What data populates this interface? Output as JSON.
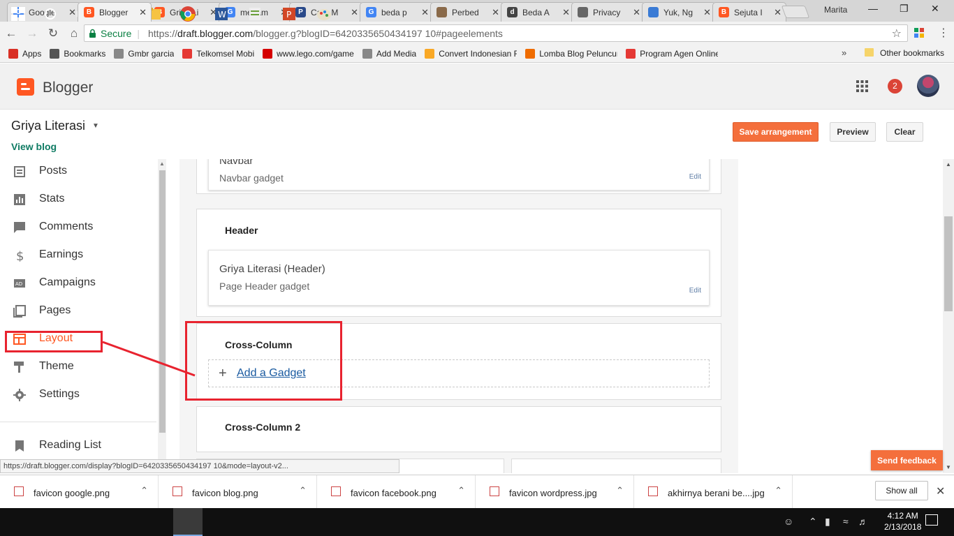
{
  "browser": {
    "tabs": [
      {
        "title": "Google",
        "favicon_color": "#4285f4",
        "favicon_letter": "G"
      },
      {
        "title": "Blogger",
        "favicon_color": "#ff5722",
        "favicon_letter": "B",
        "active": true
      },
      {
        "title": "Griya Li",
        "favicon_color": "#ff5722",
        "favicon_letter": "B"
      },
      {
        "title": "menam",
        "favicon_color": "#4285f4",
        "favicon_letter": "G"
      },
      {
        "title": "Cara M",
        "favicon_color": "#2a4a8a",
        "favicon_letter": "P"
      },
      {
        "title": "beda p",
        "favicon_color": "#4285f4",
        "favicon_letter": "G"
      },
      {
        "title": "Perbed",
        "favicon_color": "#8a6a4a",
        "favicon_letter": ""
      },
      {
        "title": "Beda A",
        "favicon_color": "#444444",
        "favicon_letter": "d"
      },
      {
        "title": "Privacy",
        "favicon_color": "#666666",
        "favicon_letter": ""
      },
      {
        "title": "Yuk, Ng",
        "favicon_color": "#3a7bd5",
        "favicon_letter": ""
      },
      {
        "title": "Sejuta I",
        "favicon_color": "#ff5722",
        "favicon_letter": "B"
      }
    ],
    "profile_name": "Marita",
    "tab_close": "✕",
    "address": {
      "secure_label": "Secure",
      "url_scheme": "https://",
      "url_host": "draft.blogger.com",
      "url_path": "/blogger.g?blogID=6420335650434197 10#pageelements"
    },
    "bookmarks": [
      {
        "label": "Apps",
        "color": "#d93025"
      },
      {
        "label": "Bookmarks",
        "color": "#555555"
      },
      {
        "label": "Gmbr garcia",
        "color": "#888888"
      },
      {
        "label": "Telkomsel Mobi",
        "color": "#e53935"
      },
      {
        "label": "www.lego.com/game",
        "color": "#d50000"
      },
      {
        "label": "Add Media",
        "color": "#888888"
      },
      {
        "label": "Convert Indonesian R",
        "color": "#f9a825"
      },
      {
        "label": "Lomba Blog Peluncur",
        "color": "#ef6c00"
      },
      {
        "label": "Program Agen Online",
        "color": "#e53935"
      }
    ],
    "bookmarks_more": "»",
    "other_bookmarks": "Other bookmarks",
    "status_url": "https://draft.blogger.com/display?blogID=6420335650434197 10&mode=layout-v2..."
  },
  "blogger": {
    "app_title": "Blogger",
    "notification_count": "2",
    "blog_name": "Griya Literasi",
    "view_blog": "View blog",
    "actions": {
      "save": "Save arrangement",
      "preview": "Preview",
      "clear": "Clear"
    },
    "sidebar": [
      {
        "label": "Posts",
        "icon": "posts-icon"
      },
      {
        "label": "Stats",
        "icon": "stats-icon"
      },
      {
        "label": "Comments",
        "icon": "comments-icon"
      },
      {
        "label": "Earnings",
        "icon": "earnings-icon"
      },
      {
        "label": "Campaigns",
        "icon": "campaigns-icon"
      },
      {
        "label": "Pages",
        "icon": "pages-icon"
      },
      {
        "label": "Layout",
        "icon": "layout-icon",
        "active": true
      },
      {
        "label": "Theme",
        "icon": "theme-icon"
      },
      {
        "label": "Settings",
        "icon": "settings-icon"
      }
    ],
    "reading_list": "Reading List",
    "accent_color": "#ff5722",
    "layout": {
      "navbar_gadget": {
        "title": "Navbar",
        "subtitle": "Navbar gadget",
        "edit": "Edit"
      },
      "header_section": "Header",
      "header_gadget": {
        "title": "Griya Literasi (Header)",
        "subtitle": "Page Header gadget",
        "edit": "Edit"
      },
      "cross_column": "Cross-Column",
      "add_gadget": "Add a Gadget",
      "cross_column_2": "Cross-Column 2"
    },
    "send_feedback": "Send feedback"
  },
  "downloads": {
    "items": [
      "favicon google.png",
      "favicon blog.png",
      "favicon facebook.png",
      "favicon wordpress.jpg",
      "akhirnya berani be....jpg"
    ],
    "show_all": "Show all"
  },
  "taskbar": {
    "time": "4:12 AM",
    "date": "2/13/2018"
  }
}
